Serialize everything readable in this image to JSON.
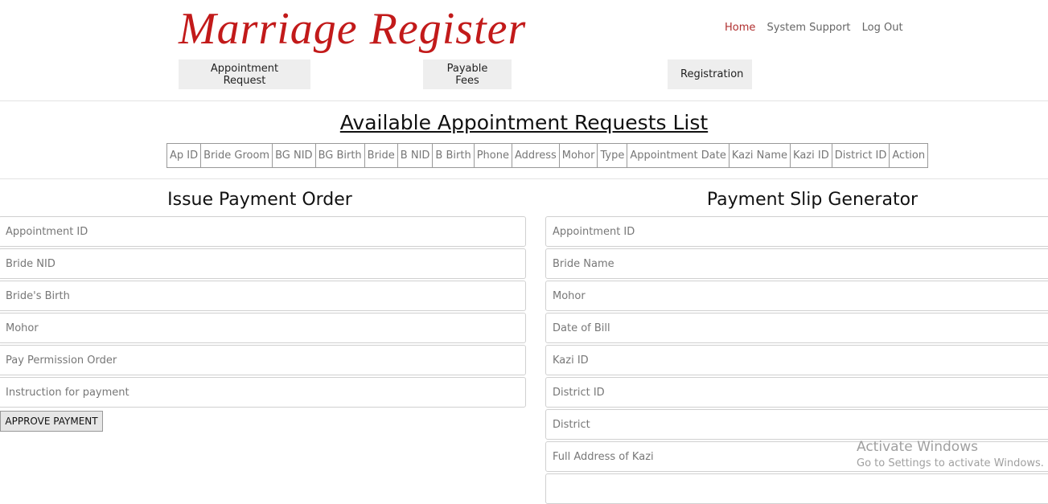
{
  "header": {
    "logo_text": "Marriage Register",
    "nav": [
      "Home",
      "System Support",
      "Log Out"
    ],
    "buttons": [
      "Appointment Request",
      "Payable Fees",
      "Registration"
    ]
  },
  "list": {
    "title": "Available Appointment Requests List",
    "columns": [
      "Ap ID",
      "Bride Groom",
      "BG NID",
      "BG Birth",
      "Bride",
      "B NID",
      "B Birth",
      "Phone",
      "Address",
      "Mohor",
      "Type",
      "Appointment Date",
      "Kazi Name",
      "Kazi ID",
      "District ID",
      "Action"
    ]
  },
  "payment_order": {
    "title": "Issue Payment Order",
    "fields": [
      "Appointment ID",
      "Bride NID",
      "Bride's Birth",
      "Mohor",
      "Pay Permission Order",
      "Instruction for payment"
    ],
    "approve_label": "APPROVE PAYMENT"
  },
  "slip": {
    "title": "Payment Slip Generator",
    "fields": [
      "Appointment ID",
      "Bride Name",
      "Mohor",
      "Date of Bill",
      "Kazi ID",
      "District ID",
      "District",
      "Full Address of Kazi"
    ]
  },
  "watermark": {
    "line1": "Activate Windows",
    "line2": "Go to Settings to activate Windows."
  },
  "colors": {
    "logo": "#c21a1a",
    "nav_active": "#b03030"
  }
}
